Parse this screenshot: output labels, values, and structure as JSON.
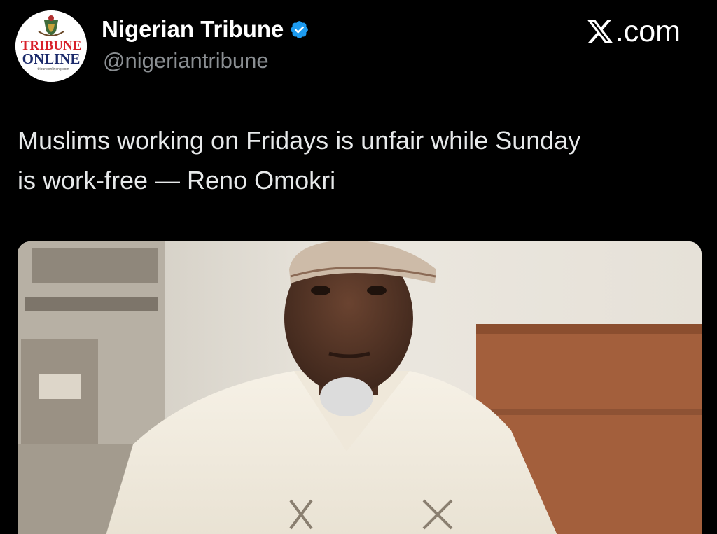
{
  "author": {
    "name": "Nigerian Tribune",
    "handle": "@nigeriantribune",
    "verified": true,
    "avatar_logo_text": [
      "TRIBUNE",
      "ONLINE",
      "tribuneonlineng.com"
    ]
  },
  "site": {
    "label": ".com",
    "logo": "x-logo-icon"
  },
  "post": {
    "text_line1": "Muslims working on Fridays is unfair while Sunday",
    "text_line2": "is work-free — Reno Omokri"
  },
  "media": {
    "type": "photo"
  },
  "colors": {
    "background": "#000000",
    "primary_text": "#e7e9ea",
    "secondary_text": "#8b8f93",
    "verified_badge": "#1d9bf0",
    "logo_red": "#d8202a",
    "logo_navy": "#1b2a6b"
  }
}
